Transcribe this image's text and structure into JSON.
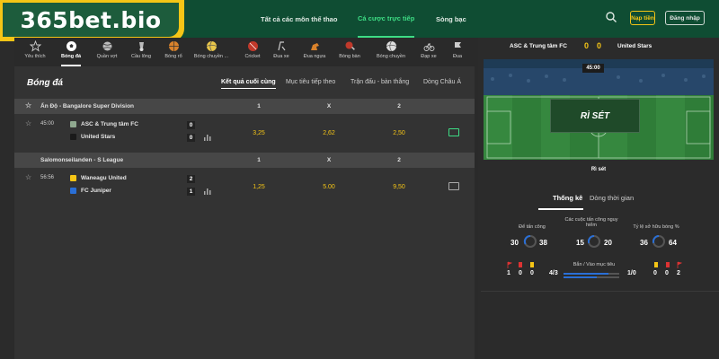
{
  "brand": {
    "logo_text": "365bet.bio"
  },
  "top_nav": {
    "items": [
      "Tất cả các môn thể thao",
      "Cá cược trực tiếp",
      "Sòng bạc"
    ],
    "deposit_label": "Nạp tiền",
    "login_label": "Đăng nhập"
  },
  "sports": [
    "Yêu thích",
    "Bóng đá",
    "Quần vợt",
    "Cầu lông",
    "Bóng rổ",
    "Bóng chuyền ...",
    "Cricket",
    "Đua xe",
    "Đua ngựa",
    "Bóng bàn",
    "Bóng chuyền",
    "Đạp xe",
    "Đua"
  ],
  "section": {
    "title": "Bóng đá",
    "tabs": [
      "Kết quả cuối cùng",
      "Mục tiêu tiếp theo",
      "Trận đấu - bàn thắng",
      "Dòng Châu Á"
    ]
  },
  "leagues": [
    {
      "name": "Ấn Độ - Bangalore Super Division",
      "headers": [
        "1",
        "X",
        "2"
      ],
      "match": {
        "time": "45:00",
        "home": "ASC & Trung tâm FC",
        "away": "United Stars",
        "home_score": "0",
        "away_score": "0",
        "odds": [
          "3,25",
          "2,62",
          "2,50"
        ]
      }
    },
    {
      "name": "Salomonseilanden - S League",
      "headers": [
        "1",
        "X",
        "2"
      ],
      "match": {
        "time": "56:56",
        "home": "Waneagu United",
        "away": "FC Juniper",
        "home_score": "2",
        "away_score": "1",
        "odds": [
          "1,25",
          "5.00",
          "9,50"
        ]
      }
    }
  ],
  "live_panel": {
    "home": "ASC & Trung tâm FC",
    "away": "United Stars",
    "home_score": "0",
    "away_score": "0",
    "clock": "45:00",
    "overlay_text": "RÌ SÉT",
    "caption": "Rì sét",
    "tabs": [
      "Thống kê",
      "Dòng thời gian"
    ],
    "stats": [
      {
        "label": "Để tấn công",
        "home": "30",
        "away": "38"
      },
      {
        "label": "Các cuộc tấn công nguy hiểm",
        "home": "15",
        "away": "20"
      },
      {
        "label": "Tỷ lệ sở hữu bóng %",
        "home": "36",
        "away": "64"
      }
    ],
    "shots": {
      "label": "Bắn / Vào mục tiêu",
      "home": "4/3",
      "away": "1/0"
    },
    "cards": {
      "home": [
        "1",
        "0",
        "0"
      ],
      "away": [
        "0",
        "0",
        "2"
      ]
    }
  },
  "colors": {
    "brand_green": "#0f4d33",
    "accent": "#3ddc84",
    "gold": "#f5c516"
  }
}
